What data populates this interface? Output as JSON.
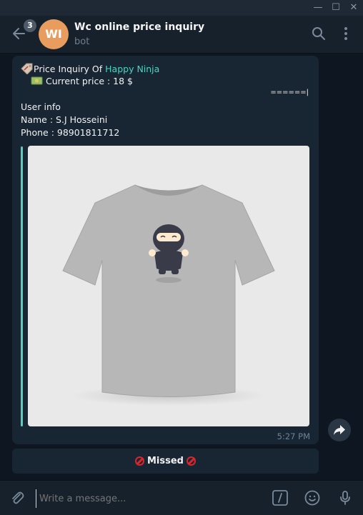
{
  "window": {
    "minimize": "—",
    "maximize": "☐",
    "close": "✕"
  },
  "header": {
    "unread_count": "3",
    "avatar_initials": "WI",
    "title": "Wc online price inquiry",
    "subtitle": "bot"
  },
  "message": {
    "line1_prefix": "Price Inquiry Of",
    "product_link": "Happy Ninja",
    "line2": "Current price : 18 $",
    "separator": "======|",
    "user_info": "User info",
    "name": "Name : S.J Hosseini",
    "phone": "Phone : 98901811712",
    "time": "5:27 PM"
  },
  "status_button": {
    "label": "Missed"
  },
  "composer": {
    "placeholder": "Write a message..."
  }
}
